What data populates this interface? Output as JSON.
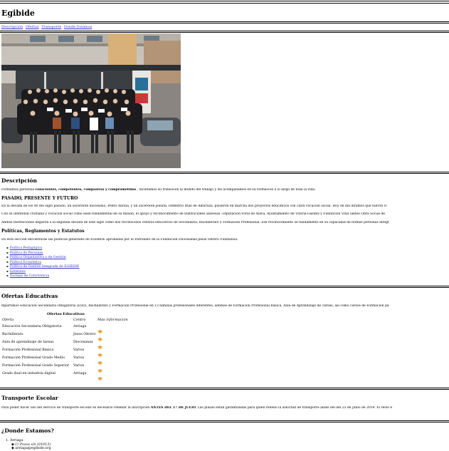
{
  "site": {
    "title": "Egibide"
  },
  "nav": {
    "items": [
      "Descripción",
      "Ofertas",
      "Transporte",
      "Donde Estamos"
    ]
  },
  "description": {
    "heading": "Descripción",
    "intro_prefix": "Formamos personas ",
    "intro_bold": "conscientes, competentes, compasivas y comprometidas",
    "intro_suffix": " , facilitamos su transición al mundo del trabajo y les acompañamos en su formación a lo largo de toda la vida.",
    "history_heading": "PASADO, PRESENTE Y FUTURO",
    "history_p1": "En la década de los 40 del siglo pasado, un sacerdote diocesano, Pedro Anitua, y un sacerdote jesuita, Demetrio Ruiz de Alburuza, pusieron en marcha dos proyectos educativos con clara vocación social. Hoy en día dirámos que fueron vi",
    "history_p2": "Con su identidad cristiana y vocación social como base fundamental de su misión, el apoyo y reconocimiento de Instituciones alavesas –Diputación Foral de Álava, Ayuntamiento de Vitoria-Gasteiz y Fundación Vital (antes Obra Social de",
    "history_p3": "Ambas instituciones llegaron a la segunda década de este siglo como dos reconocidos centros educativos de Secundaria, Bachillerato y Formación Profesional. Ese reconocimiento se fundamentó en su capacidad de formar personas integr",
    "policies_heading": "Políticas, Reglamentos y Estatutos",
    "policies_text": "En esta sección encontrarás las políticas generales de EGIBIDE aprobadas por el Patronato de la Fundación Diocesanas-Jesús Obrero Fundazioa.",
    "policy_links": [
      "Política Pedagógica",
      "Política de Personas",
      "Política Organizativa y de Gestión",
      "Política Económica",
      "Política de Gestión Integrada de EGIBIDE",
      "Estatutos",
      "Normas de Convivencia"
    ]
  },
  "ofertas": {
    "heading": "Ofertas Educativas",
    "intro": "mpartimos Educación Secundaria Obligatoria (ESO), Bachillerato y Formación Profesional en 13 familias profesionales diferentes, además de Formación Profesional Básica, Aula de Aprendizaje de Tareas, así como cursos de Formación pa",
    "table_caption": "Ofertas Educativas",
    "columns": [
      "Oferta",
      "Centro",
      "Más información"
    ],
    "rows": [
      {
        "oferta": "Educación Secundaria Obligatoria",
        "centro": "Arriaga"
      },
      {
        "oferta": "Bachillerato",
        "centro": "Jesus Obrero"
      },
      {
        "oferta": "Aula de aprendizaje de tareas",
        "centro": "Diocesanas"
      },
      {
        "oferta": "Formación Profesional Básica",
        "centro": "Varios"
      },
      {
        "oferta": "Formación Profesional Grado Medio",
        "centro": "Varios"
      },
      {
        "oferta": "Formación Profesional Grado Superior",
        "centro": "Varios"
      },
      {
        "oferta": "Grado dual en industria digital",
        "centro": "Arriaga"
      }
    ],
    "info_icon": "graduation-cap-icon",
    "info_icon_color": "#e8a13a"
  },
  "transporte": {
    "heading": "Transporte Escolar",
    "text_prefix": "Para poder hacer uso del servicio de transporte escolar es necesario rellenar la inscripción ",
    "text_bold": "ANTES DEL 17 DE JULIO",
    "text_suffix": ". Las plazas están garantizadas para quien rellenó la solicitud de transporte antes del del 25 de Junio de 2019. El resto e"
  },
  "donde": {
    "heading": "¿Donde Estamos?",
    "locations": [
      {
        "number": "1.",
        "name": "Arriaga",
        "address": "C/ Pozos s/n (01013)",
        "email": "arriaga@egibide.org"
      }
    ]
  },
  "colors": {
    "link": "#3333cc",
    "text": "#000000",
    "background": "#ffffff"
  }
}
